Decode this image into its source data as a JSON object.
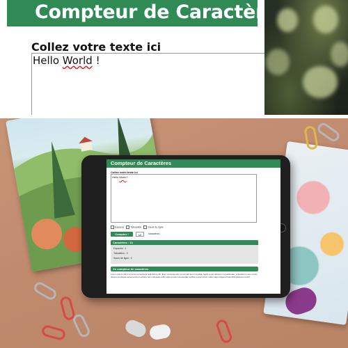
{
  "top": {
    "title": "Compteur de Caractères",
    "label": "Collez votre texte ici",
    "text_before": "Hello ",
    "text_squiggle": "World",
    "text_after": " !"
  },
  "tablet": {
    "title": "Compteur de Caractères",
    "label": "Collez votre texte ici",
    "text_before": "Hello ",
    "text_squiggle": "World",
    "text_after": " !",
    "options": {
      "espaces": "Espaces",
      "tabulation": "Tabulation",
      "sauts": "Sauts de ligne"
    },
    "count_button": "Comptez !",
    "count_value": "12",
    "count_unit": "caractères",
    "stats_header": "Caractères : 13",
    "stat_espaces": "Espaces : 1",
    "stat_tabulation": "Tabulation : 0",
    "stat_sauts": "Sauts de ligne : 0",
    "about_header": "Ce compteur de caractères",
    "about_text": "Lorem ipsum dolor sit amet consectetur adipisicing elit. Illum consequuntur commodi rerum repellat, facilis quam laborum repudiandae, voluptatum enim omnis dolores similique assumenda provident nam voluptate nihil culpa omnis recusandae mollitia ut quis lorem nulla magni eligendi blanditiis placeat omnis?"
  },
  "colors": {
    "accent": "#2f8a55"
  }
}
